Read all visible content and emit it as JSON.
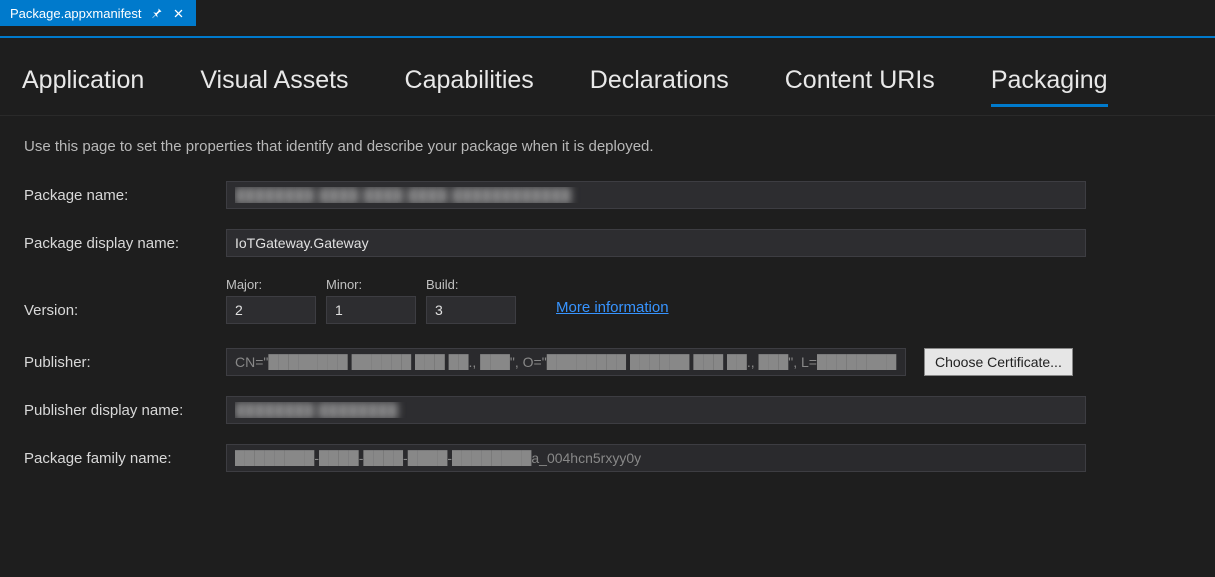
{
  "tab": {
    "title": "Package.appxmanifest"
  },
  "nav": {
    "application": "Application",
    "visual_assets": "Visual Assets",
    "capabilities": "Capabilities",
    "declarations": "Declarations",
    "content_uris": "Content URIs",
    "packaging": "Packaging"
  },
  "description": "Use this page to set the properties that identify and describe your package when it is deployed.",
  "labels": {
    "package_name": "Package name:",
    "package_display_name": "Package display name:",
    "version": "Version:",
    "major": "Major:",
    "minor": "Minor:",
    "build": "Build:",
    "publisher": "Publisher:",
    "publisher_display_name": "Publisher display name:",
    "package_family_name": "Package family name:"
  },
  "values": {
    "package_name": "████████-████-████-████-████████████",
    "package_display_name": "IoTGateway.Gateway",
    "version_major": "2",
    "version_minor": "1",
    "version_build": "3",
    "publisher": "CN=\"████████ ██████ ███ ██., ███\", O=\"████████ ██████ ███ ██., ███\", L=████████, S=",
    "publisher_display_name": "████████ ████████",
    "package_family_name": "████████-████-████-████-████████a_004hcn5rxyy0y"
  },
  "links": {
    "more_info": "More information"
  },
  "buttons": {
    "choose_certificate": "Choose Certificate..."
  }
}
